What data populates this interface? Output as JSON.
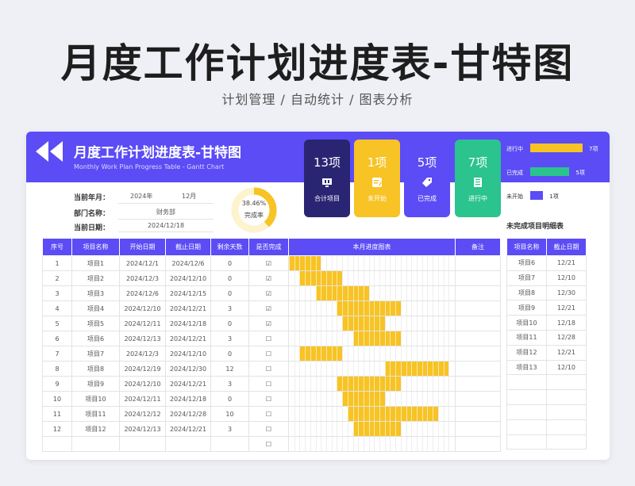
{
  "page": {
    "title": "月度工作计划进度表-甘特图",
    "subtitle": "计划管理 / 自动统计 / 图表分析"
  },
  "header": {
    "title": "月度工作计划进度表-甘特图",
    "subtitle": "Monthly Work Plan Progress Table - Gantt Chart"
  },
  "kpis": [
    {
      "value": "13项",
      "label": "合计项目",
      "icon": "monitor-icon",
      "color": "#2a2572"
    },
    {
      "value": "1项",
      "label": "未开始",
      "icon": "note-icon",
      "color": "#f7c325"
    },
    {
      "value": "5项",
      "label": "已完成",
      "icon": "tag-icon",
      "color": "#5b4cf5"
    },
    {
      "value": "7项",
      "label": "进行中",
      "icon": "list-icon",
      "color": "#2bc38e"
    }
  ],
  "legend": [
    {
      "label": "进行中",
      "count": "7项",
      "value": 7,
      "color": "#f7c325"
    },
    {
      "label": "已完成",
      "count": "5项",
      "value": 5,
      "color": "#2bc38e"
    },
    {
      "label": "未开始",
      "count": "1项",
      "value": 1,
      "color": "#5b4cf5"
    }
  ],
  "info": {
    "month_label": "当前年月：",
    "year": "2024年",
    "month": "12月",
    "dept_label": "部门名称：",
    "dept": "财务部",
    "date_label": "当前日期：",
    "date": "2024/12/18"
  },
  "completion": {
    "percent_text": "38.46%",
    "label": "完成率",
    "value": 0.3846
  },
  "table": {
    "headers": [
      "序号",
      "项目名称",
      "开始日期",
      "截止日期",
      "剩余天数",
      "是否完成",
      "本月进度图表",
      "备注"
    ],
    "rows": [
      {
        "no": "1",
        "name": "项目1",
        "start": "2024/12/1",
        "end": "2024/12/6",
        "remain": "0",
        "done": "☑",
        "s": 1,
        "e": 6
      },
      {
        "no": "2",
        "name": "项目2",
        "start": "2024/12/3",
        "end": "2024/12/10",
        "remain": "0",
        "done": "☑",
        "s": 3,
        "e": 10
      },
      {
        "no": "3",
        "name": "项目3",
        "start": "2024/12/6",
        "end": "2024/12/15",
        "remain": "0",
        "done": "☑",
        "s": 6,
        "e": 15
      },
      {
        "no": "4",
        "name": "项目4",
        "start": "2024/12/10",
        "end": "2024/12/21",
        "remain": "3",
        "done": "☑",
        "s": 10,
        "e": 21
      },
      {
        "no": "5",
        "name": "项目5",
        "start": "2024/12/11",
        "end": "2024/12/18",
        "remain": "0",
        "done": "☑",
        "s": 11,
        "e": 18
      },
      {
        "no": "6",
        "name": "项目6",
        "start": "2024/12/13",
        "end": "2024/12/21",
        "remain": "3",
        "done": "☐",
        "s": 13,
        "e": 21
      },
      {
        "no": "7",
        "name": "项目7",
        "start": "2024/12/3",
        "end": "2024/12/10",
        "remain": "0",
        "done": "☐",
        "s": 3,
        "e": 10
      },
      {
        "no": "8",
        "name": "项目8",
        "start": "2024/12/19",
        "end": "2024/12/30",
        "remain": "12",
        "done": "☐",
        "s": 19,
        "e": 30
      },
      {
        "no": "9",
        "name": "项目9",
        "start": "2024/12/10",
        "end": "2024/12/21",
        "remain": "3",
        "done": "☐",
        "s": 10,
        "e": 21
      },
      {
        "no": "10",
        "name": "项目10",
        "start": "2024/12/11",
        "end": "2024/12/18",
        "remain": "0",
        "done": "☐",
        "s": 11,
        "e": 18
      },
      {
        "no": "11",
        "name": "项目11",
        "start": "2024/12/12",
        "end": "2024/12/28",
        "remain": "10",
        "done": "☐",
        "s": 12,
        "e": 28
      },
      {
        "no": "12",
        "name": "项目12",
        "start": "2024/12/13",
        "end": "2024/12/21",
        "remain": "3",
        "done": "☐",
        "s": 13,
        "e": 21
      },
      {
        "no": "",
        "name": "",
        "start": "",
        "end": "",
        "remain": "",
        "done": "☐",
        "s": 0,
        "e": 0
      }
    ]
  },
  "side": {
    "title": "未完成项目明细表",
    "headers": [
      "项目名称",
      "截止日期"
    ],
    "rows": [
      [
        "项目6",
        "12/21"
      ],
      [
        "项目7",
        "12/10"
      ],
      [
        "项目8",
        "12/30"
      ],
      [
        "项目9",
        "12/21"
      ],
      [
        "项目10",
        "12/18"
      ],
      [
        "项目11",
        "12/28"
      ],
      [
        "项目12",
        "12/21"
      ],
      [
        "项目13",
        "12/10"
      ],
      [
        "",
        ""
      ],
      [
        "",
        ""
      ],
      [
        "",
        ""
      ],
      [
        "",
        ""
      ],
      [
        "",
        ""
      ]
    ]
  }
}
